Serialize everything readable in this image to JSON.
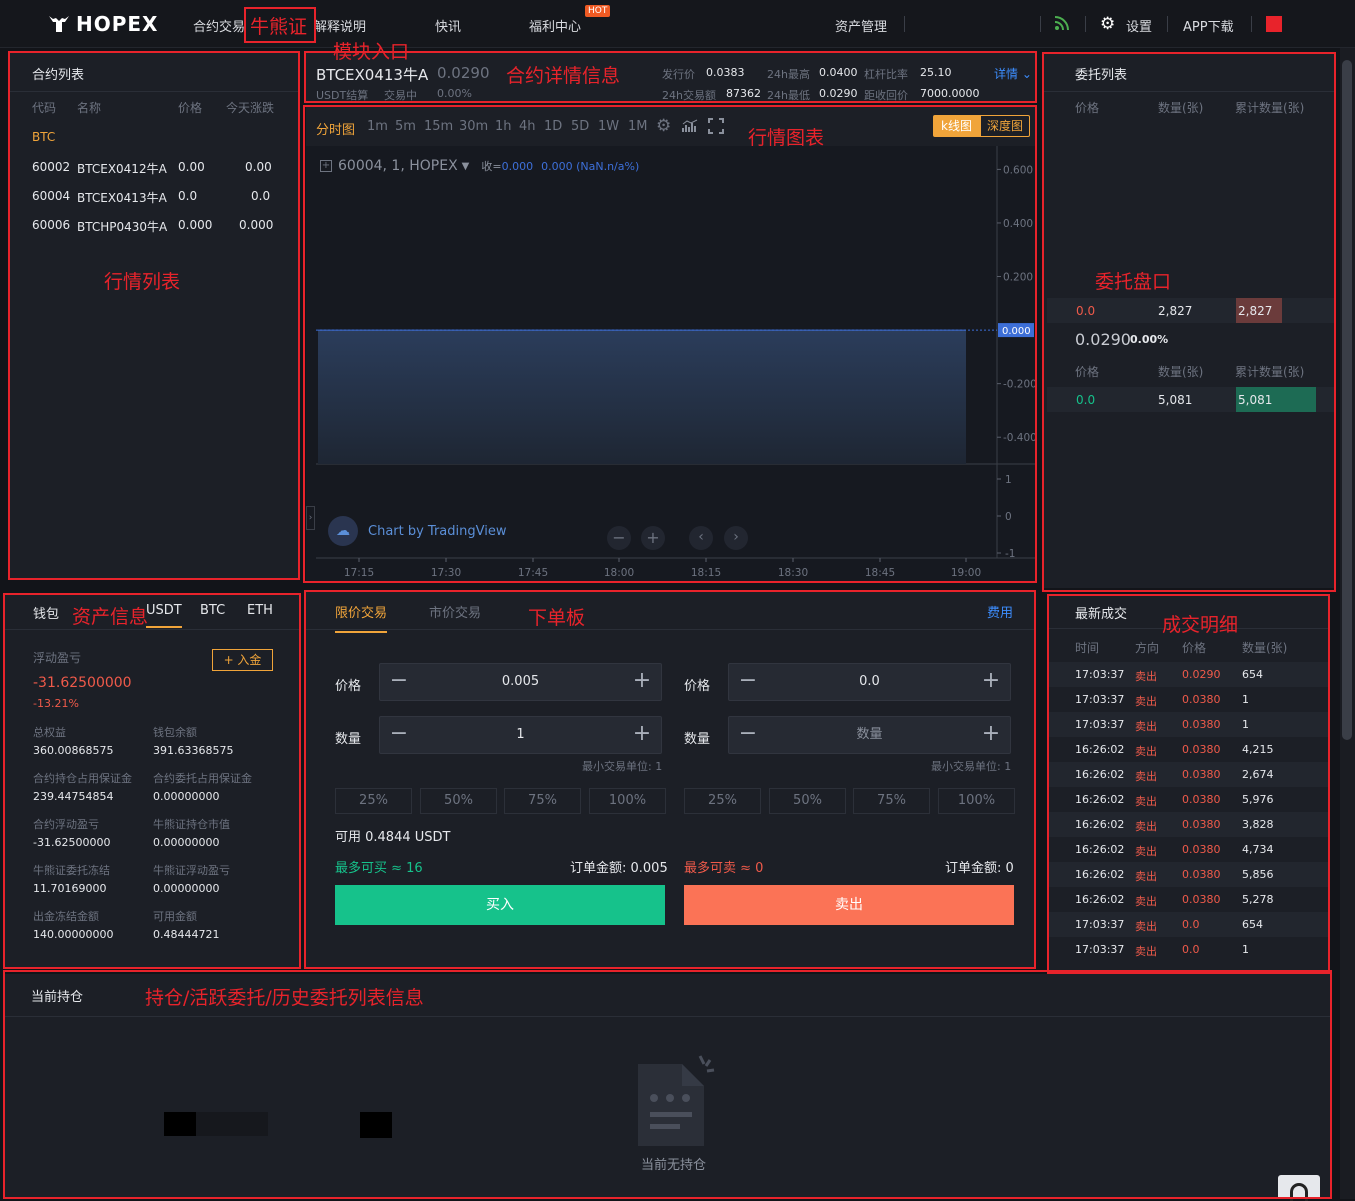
{
  "header": {
    "logo": "HOPEX",
    "nav": [
      "合约交易",
      "解释说明",
      "快讯",
      "福利中心"
    ],
    "hot": "HOT",
    "asset": "资产管理",
    "settings": "设置",
    "app": "APP下载"
  },
  "annotations": {
    "bull": "牛熊证",
    "module": "模块入口",
    "detail": "合约详情信息",
    "market_list": "行情列表",
    "chart": "行情图表",
    "orderbook": "委托盘口",
    "asset": "资产信息",
    "order_panel": "下单板",
    "trades": "成交明细",
    "positions": "持仓/活跃委托/历史委托列表信息"
  },
  "contract_list": {
    "title": "合约列表",
    "headers": [
      "代码",
      "名称",
      "价格",
      "今天涨跌"
    ],
    "group": "BTC",
    "rows": [
      {
        "code": "60002",
        "name": "BTCEX0412牛A",
        "price": "0.00",
        "change": "0.00"
      },
      {
        "code": "60004",
        "name": "BTCEX0413牛A",
        "price": "0.0",
        "change": "0.0"
      },
      {
        "code": "60006",
        "name": "BTCHP0430牛A",
        "price": "0.000",
        "change": "0.000"
      }
    ]
  },
  "contract_detail": {
    "name": "BTCEX0413牛A",
    "price": "0.0290",
    "settle": "USDT结算",
    "status": "交易中",
    "pct": "0.00%",
    "labels": {
      "issue": "发行价",
      "high": "24h最高",
      "lev": "杠杆比率",
      "vol": "24h交易额",
      "low": "24h最低",
      "recall": "距收回价"
    },
    "values": {
      "issue": "0.0383",
      "high": "0.0400",
      "lev": "25.10",
      "vol": "87362",
      "low": "0.0290",
      "recall": "7000.0000"
    },
    "more": "详情"
  },
  "chart_toolbar": {
    "intervals": [
      "分时图",
      "1m",
      "5m",
      "15m",
      "30m",
      "1h",
      "4h",
      "1D",
      "5D",
      "1W",
      "1M"
    ],
    "kline": "k线图",
    "depth": "深度图"
  },
  "chart": {
    "symbol": "60004, 1, HOPEX",
    "close_label": "收=",
    "close": "0.000",
    "change": "0.000 (NaN.n/a%)",
    "tv": "Chart by TradingView",
    "price_badge": "0.000"
  },
  "chart_data": {
    "type": "area",
    "x": [
      "17:15",
      "17:30",
      "17:45",
      "18:00",
      "18:15",
      "18:30",
      "18:45",
      "19:00"
    ],
    "series": [
      {
        "values": [
          0,
          0,
          0,
          0,
          0,
          0,
          0,
          0
        ]
      }
    ],
    "yticks": [
      "0.600",
      "0.400",
      "0.200",
      "-0.200",
      "-0.400"
    ],
    "ylim": [
      -0.5,
      0.65
    ],
    "vol_ticks": [
      "1",
      "0",
      "-1"
    ],
    "colors": {
      "area": "#2b3d5b",
      "line": "#3d6fd8"
    }
  },
  "orderbook": {
    "title": "委托列表",
    "headers": [
      "价格",
      "数量(张)",
      "累计数量(张)"
    ],
    "ask": {
      "price": "0.0",
      "qty": "2,827",
      "cum": "2,827"
    },
    "last": "0.0290",
    "last_pct": "0.00%",
    "bid": {
      "price": "0.0",
      "qty": "5,081",
      "cum": "5,081"
    }
  },
  "wallet": {
    "title": "钱包",
    "tabs": [
      "USDT",
      "BTC",
      "ETH"
    ],
    "float_label": "浮动盈亏",
    "deposit": "+ 入金",
    "float_value": "-31.62500000",
    "float_pct": "-13.21%",
    "items": [
      {
        "label": "总权益",
        "value": "360.00868575"
      },
      {
        "label": "钱包余额",
        "value": "391.63368575"
      },
      {
        "label": "合约持仓占用保证金",
        "value": "239.44754854"
      },
      {
        "label": "合约委托占用保证金",
        "value": "0.00000000"
      },
      {
        "label": "合约浮动盈亏",
        "value": "-31.62500000"
      },
      {
        "label": "牛熊证持仓市值",
        "value": "0.00000000"
      },
      {
        "label": "牛熊证委托冻结",
        "value": "11.70169000"
      },
      {
        "label": "牛熊证浮动盈亏",
        "value": "0.00000000"
      },
      {
        "label": "出金冻结金额",
        "value": "140.00000000"
      },
      {
        "label": "可用金额",
        "value": "0.48444721"
      }
    ]
  },
  "order_form": {
    "tabs": [
      "限价交易",
      "市价交易"
    ],
    "fee": "费用",
    "price_label": "价格",
    "qty_label": "数量",
    "buy_price": "0.005",
    "buy_qty": "1",
    "sell_price": "0.0",
    "sell_qty_ph": "数量",
    "min_unit": "最小交易单位: 1",
    "pcts": [
      "25%",
      "50%",
      "75%",
      "100%"
    ],
    "available": "可用 0.4844 USDT",
    "max_buy": "最多可买 ≈ 16",
    "buy_amount": "订单金额: 0.005",
    "max_sell": "最多可卖 ≈ 0",
    "sell_amount": "订单金额: 0",
    "buy": "买入",
    "sell": "卖出"
  },
  "trades": {
    "title": "最新成交",
    "headers": [
      "时间",
      "方向",
      "价格",
      "数量(张)"
    ],
    "rows": [
      [
        "17:03:37",
        "卖出",
        "0.0290",
        "654"
      ],
      [
        "17:03:37",
        "卖出",
        "0.0380",
        "1"
      ],
      [
        "17:03:37",
        "卖出",
        "0.0380",
        "1"
      ],
      [
        "16:26:02",
        "卖出",
        "0.0380",
        "4,215"
      ],
      [
        "16:26:02",
        "卖出",
        "0.0380",
        "2,674"
      ],
      [
        "16:26:02",
        "卖出",
        "0.0380",
        "5,976"
      ],
      [
        "16:26:02",
        "卖出",
        "0.0380",
        "3,828"
      ],
      [
        "16:26:02",
        "卖出",
        "0.0380",
        "4,734"
      ],
      [
        "16:26:02",
        "卖出",
        "0.0380",
        "5,856"
      ],
      [
        "16:26:02",
        "卖出",
        "0.0380",
        "5,278"
      ],
      [
        "17:03:37",
        "卖出",
        "0.0",
        "654"
      ],
      [
        "17:03:37",
        "卖出",
        "0.0",
        "1"
      ]
    ]
  },
  "positions": {
    "title": "当前持仓",
    "empty": "当前无持仓"
  }
}
